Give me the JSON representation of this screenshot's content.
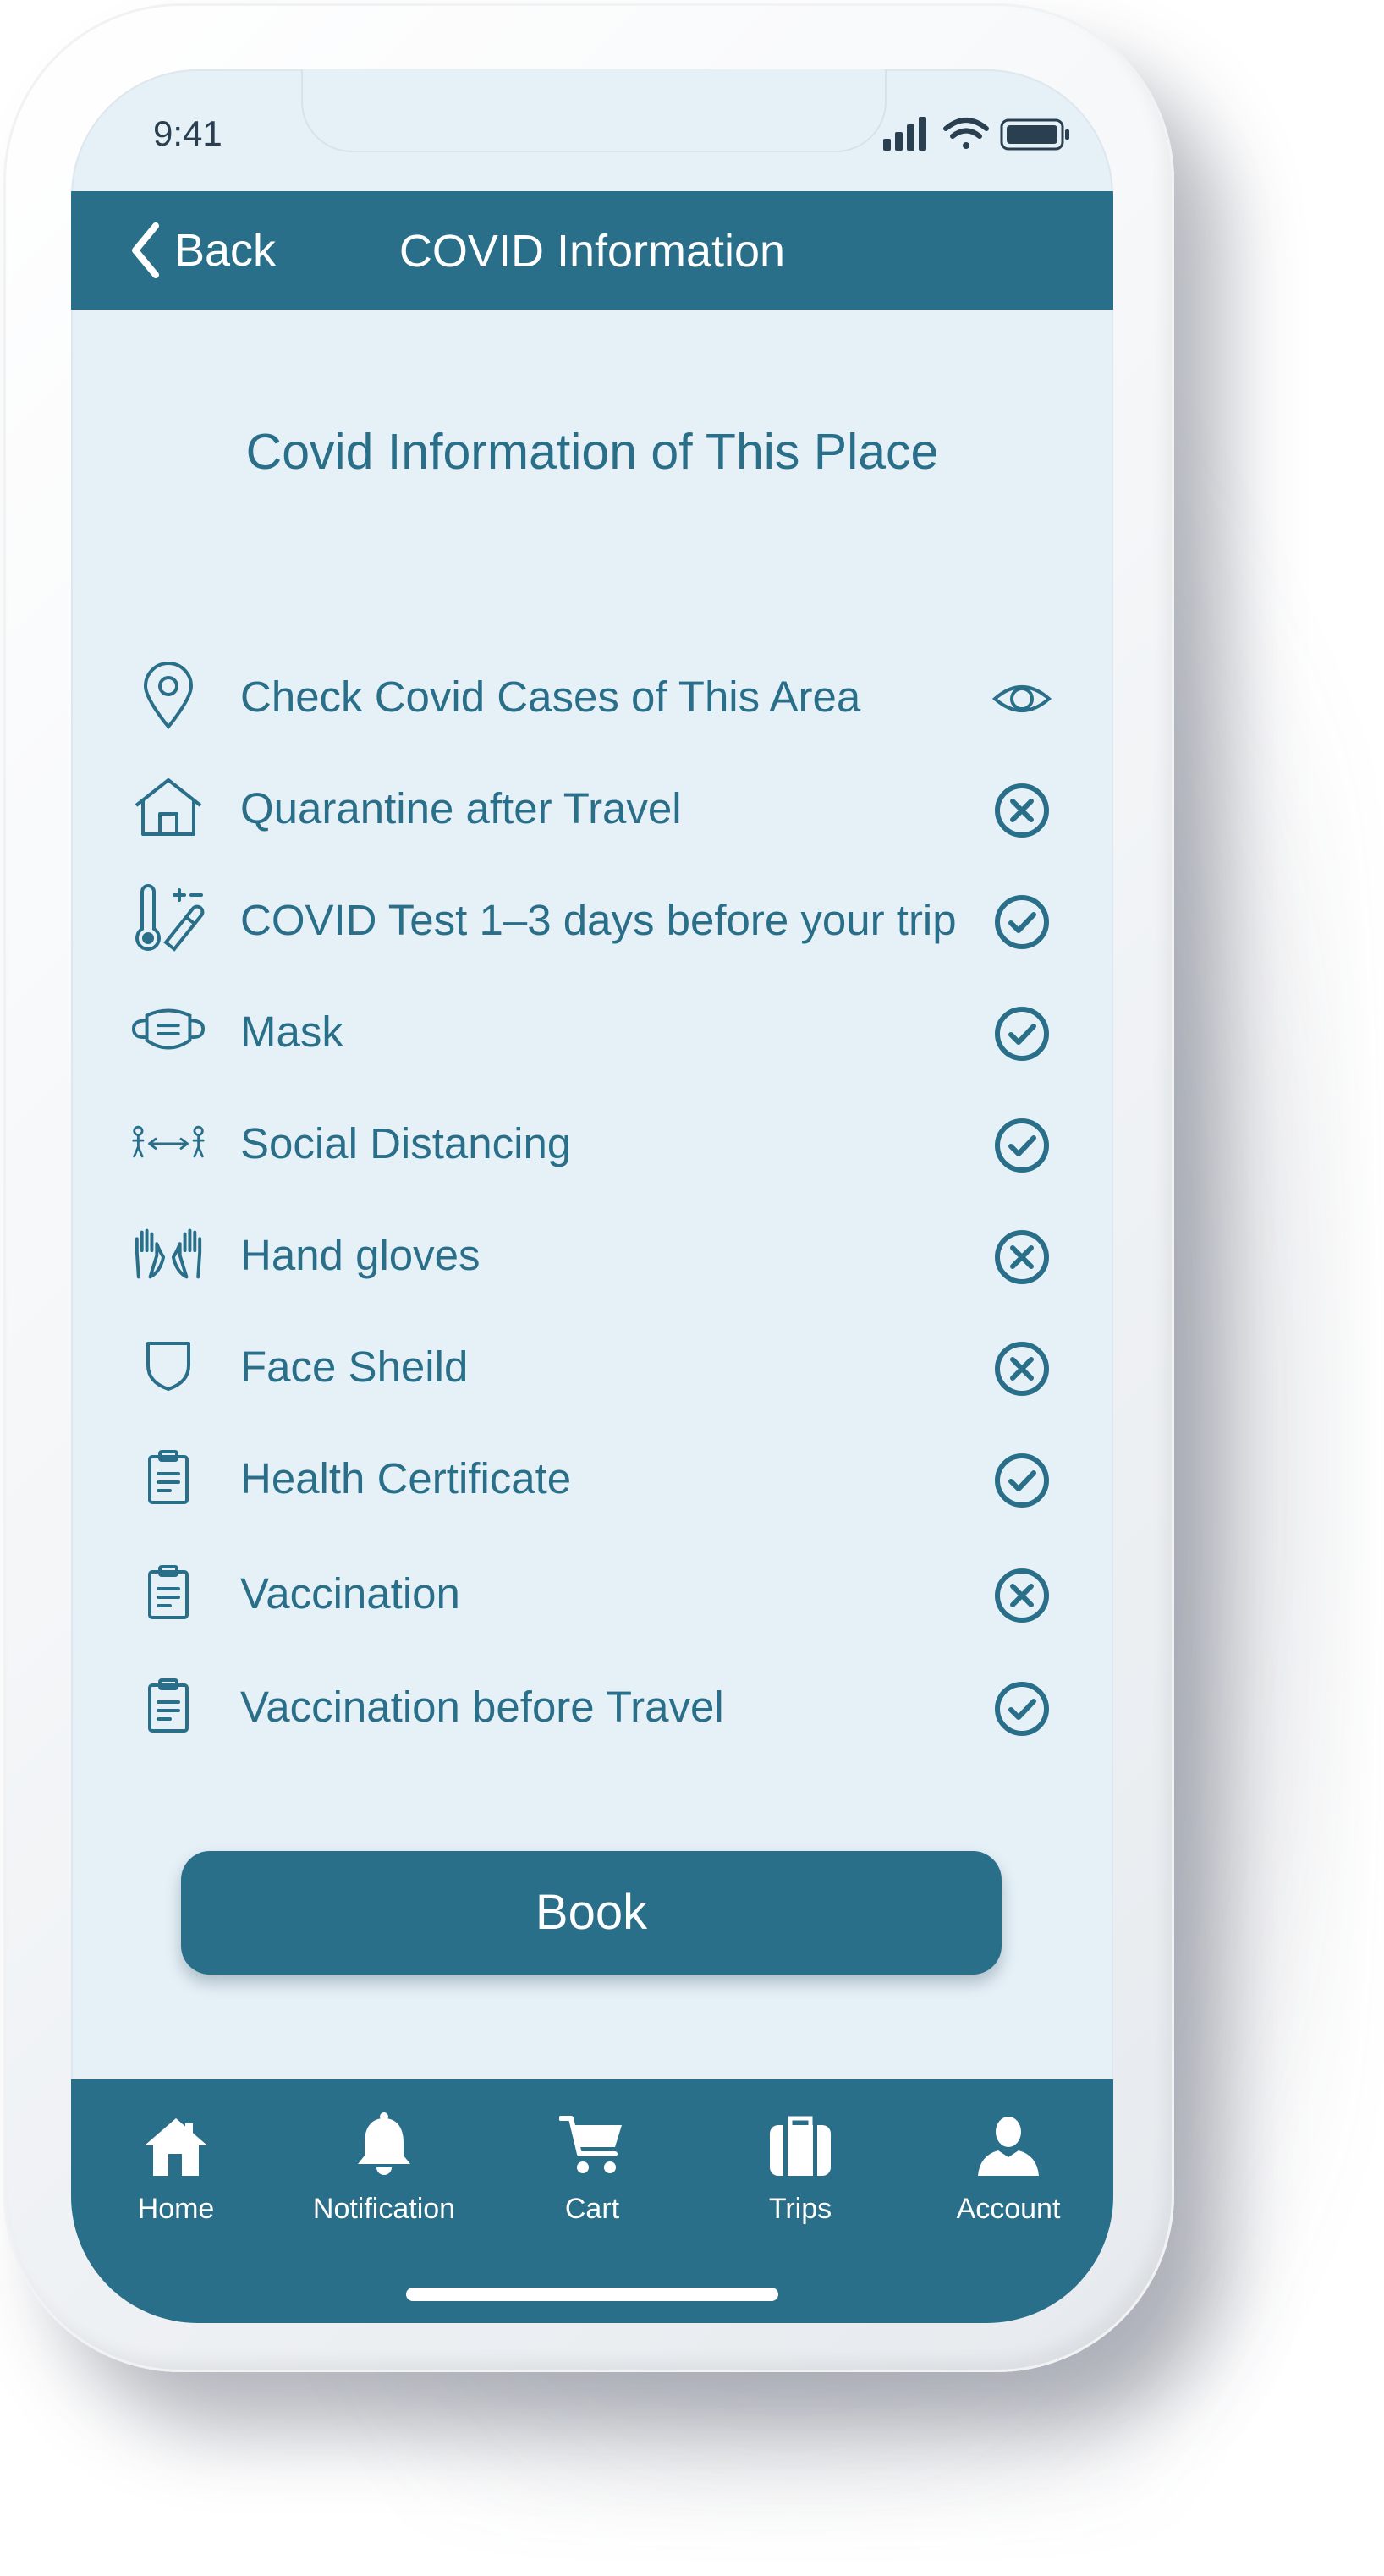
{
  "status_bar": {
    "time": "9:41"
  },
  "app_bar": {
    "back_label": "Back",
    "title": "COVID Information"
  },
  "main": {
    "heading": "Covid Information of This Place",
    "rules": [
      {
        "label": "Check Covid Cases of This Area",
        "icon": "location-pin-icon",
        "status": "view",
        "status_icon": "eye-icon"
      },
      {
        "label": "Quarantine after Travel",
        "icon": "house-icon",
        "status": "not-required",
        "status_icon": "x-circle-icon"
      },
      {
        "label": "COVID Test 1–3 days before your trip",
        "icon": "thermometer-dropper-icon",
        "status": "required",
        "status_icon": "check-circle-icon"
      },
      {
        "label": "Mask",
        "icon": "mask-icon",
        "status": "required",
        "status_icon": "check-circle-icon"
      },
      {
        "label": "Social Distancing",
        "icon": "social-distancing-icon",
        "status": "required",
        "status_icon": "check-circle-icon"
      },
      {
        "label": "Hand gloves",
        "icon": "hands-icon",
        "status": "not-required",
        "status_icon": "x-circle-icon"
      },
      {
        "label": "Face Sheild",
        "icon": "shield-icon",
        "status": "not-required",
        "status_icon": "x-circle-icon"
      },
      {
        "label": "Health Certificate",
        "icon": "clipboard-icon",
        "status": "required",
        "status_icon": "check-circle-icon"
      },
      {
        "label": "Vaccination",
        "icon": "clipboard-icon",
        "status": "not-required",
        "status_icon": "x-circle-icon"
      },
      {
        "label": "Vaccination before Travel",
        "icon": "clipboard-icon",
        "status": "required",
        "status_icon": "check-circle-icon"
      }
    ],
    "book_label": "Book"
  },
  "tab_bar": {
    "tabs": [
      {
        "label": "Home",
        "icon": "home-icon"
      },
      {
        "label": "Notification",
        "icon": "bell-icon"
      },
      {
        "label": "Cart",
        "icon": "cart-icon"
      },
      {
        "label": "Trips",
        "icon": "suitcase-icon"
      },
      {
        "label": "Account",
        "icon": "user-icon"
      }
    ]
  },
  "colors": {
    "primary": "#2a6f89",
    "screen_background": "#e6f0f7",
    "on_primary": "#ffffff"
  }
}
